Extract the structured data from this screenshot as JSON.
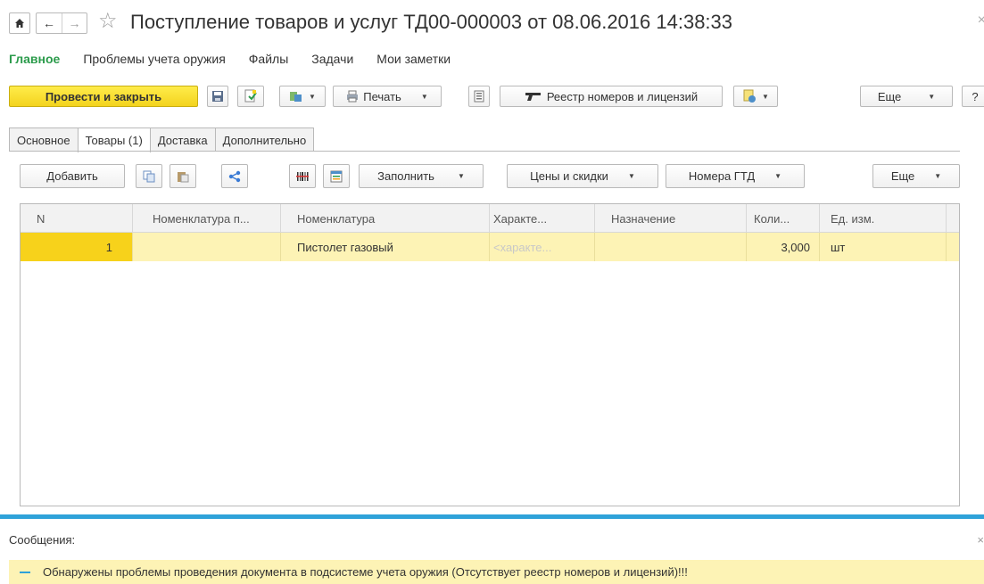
{
  "window": {
    "title": "Поступление товаров и услуг ТД00-000003 от 08.06.2016 14:38:33",
    "close_glyph": "×"
  },
  "sections": [
    {
      "label": "Главное"
    },
    {
      "label": "Проблемы учета оружия"
    },
    {
      "label": "Файлы"
    },
    {
      "label": "Задачи"
    },
    {
      "label": "Мои заметки"
    }
  ],
  "toolbar": {
    "post_close_label": "Провести и закрыть",
    "print_label": "Печать",
    "registry_label": "Реестр номеров и лицензий",
    "more_label": "Еще",
    "help_label": "?"
  },
  "tabs": [
    {
      "label": "Основное"
    },
    {
      "label": "Товары (1)"
    },
    {
      "label": "Доставка"
    },
    {
      "label": "Дополнительно"
    }
  ],
  "goods_toolbar": {
    "add_label": "Добавить",
    "fill_label": "Заполнить",
    "prices_label": "Цены и скидки",
    "gtd_label": "Номера ГТД",
    "more_label": "Еще"
  },
  "table": {
    "columns": [
      "N",
      "Номенклатура п...",
      "Номенклатура",
      "Характе...",
      "Назначение",
      "Коли...",
      "Ед. изм."
    ],
    "rows": [
      {
        "n": "1",
        "supplier_item": "",
        "item": "Пистолет газовый",
        "characteristic": "<характе...",
        "purpose": "",
        "qty": "3,000",
        "unit": "шт"
      }
    ]
  },
  "messages": {
    "title": "Сообщения:",
    "close_glyph": "×",
    "items": [
      {
        "text": "Обнаружены проблемы проведения документа в подсистеме учета оружия (Отсутствует реестр номеров и лицензий)!!!"
      }
    ]
  },
  "colors": {
    "accent_green": "#2b9b4b",
    "primary_yellow": "#f3d31e",
    "selection_yellow": "#fdf3b5",
    "message_blue": "#2fa2d9"
  }
}
